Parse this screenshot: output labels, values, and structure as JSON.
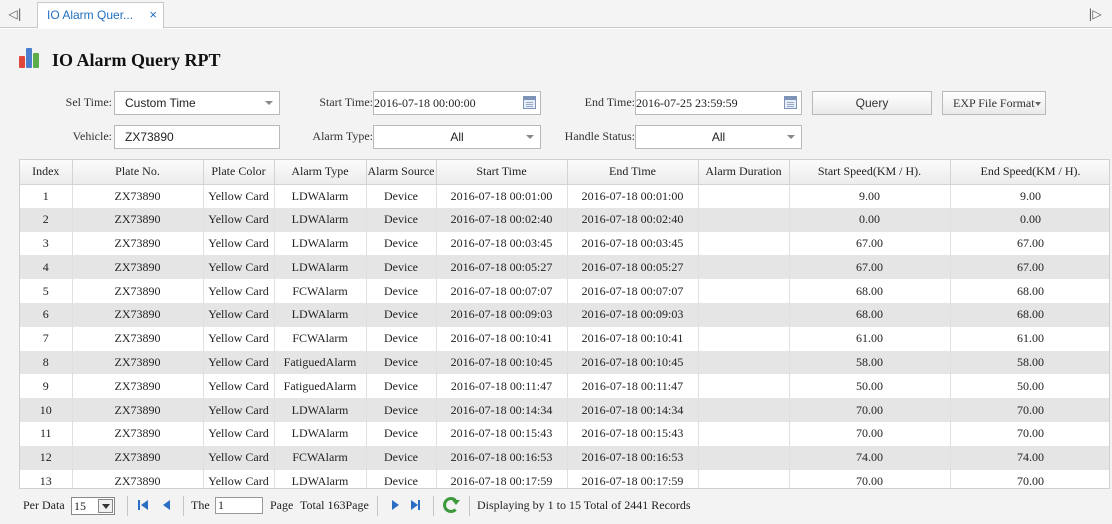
{
  "tabs": {
    "nav_left": "◁|",
    "nav_right": "|▷",
    "active_label": "IO Alarm Quer...",
    "close_glyph": "×"
  },
  "page": {
    "title": "IO Alarm Query RPT",
    "icon": "bar-chart-icon"
  },
  "filters": {
    "sel_time_label": "Sel Time:",
    "sel_time_value": "Custom Time",
    "start_time_label": "Start Time:",
    "start_time_value": "2016-07-18 00:00:00",
    "end_time_label": "End Time:",
    "end_time_value": "2016-07-25 23:59:59",
    "query_label": "Query",
    "exp_label": "EXP File Format",
    "vehicle_label": "Vehicle:",
    "vehicle_value": "ZX73890",
    "alarm_type_label": "Alarm Type:",
    "alarm_type_value": "All",
    "handle_status_label": "Handle Status:",
    "handle_status_value": "All"
  },
  "grid": {
    "columns": [
      "Index",
      "Plate No.",
      "Plate Color",
      "Alarm Type",
      "Alarm Source",
      "Start Time",
      "End Time",
      "Alarm Duration",
      "Start Speed(KM / H).",
      "End Speed(KM / H)."
    ],
    "rows": [
      [
        "1",
        "ZX73890",
        "Yellow Card",
        "LDWAlarm",
        "Device",
        "2016-07-18 00:01:00",
        "2016-07-18 00:01:00",
        "",
        "9.00",
        "9.00"
      ],
      [
        "2",
        "ZX73890",
        "Yellow Card",
        "LDWAlarm",
        "Device",
        "2016-07-18 00:02:40",
        "2016-07-18 00:02:40",
        "",
        "0.00",
        "0.00"
      ],
      [
        "3",
        "ZX73890",
        "Yellow Card",
        "LDWAlarm",
        "Device",
        "2016-07-18 00:03:45",
        "2016-07-18 00:03:45",
        "",
        "67.00",
        "67.00"
      ],
      [
        "4",
        "ZX73890",
        "Yellow Card",
        "LDWAlarm",
        "Device",
        "2016-07-18 00:05:27",
        "2016-07-18 00:05:27",
        "",
        "67.00",
        "67.00"
      ],
      [
        "5",
        "ZX73890",
        "Yellow Card",
        "FCWAlarm",
        "Device",
        "2016-07-18 00:07:07",
        "2016-07-18 00:07:07",
        "",
        "68.00",
        "68.00"
      ],
      [
        "6",
        "ZX73890",
        "Yellow Card",
        "LDWAlarm",
        "Device",
        "2016-07-18 00:09:03",
        "2016-07-18 00:09:03",
        "",
        "68.00",
        "68.00"
      ],
      [
        "7",
        "ZX73890",
        "Yellow Card",
        "FCWAlarm",
        "Device",
        "2016-07-18 00:10:41",
        "2016-07-18 00:10:41",
        "",
        "61.00",
        "61.00"
      ],
      [
        "8",
        "ZX73890",
        "Yellow Card",
        "FatiguedAlarm",
        "Device",
        "2016-07-18 00:10:45",
        "2016-07-18 00:10:45",
        "",
        "58.00",
        "58.00"
      ],
      [
        "9",
        "ZX73890",
        "Yellow Card",
        "FatiguedAlarm",
        "Device",
        "2016-07-18 00:11:47",
        "2016-07-18 00:11:47",
        "",
        "50.00",
        "50.00"
      ],
      [
        "10",
        "ZX73890",
        "Yellow Card",
        "LDWAlarm",
        "Device",
        "2016-07-18 00:14:34",
        "2016-07-18 00:14:34",
        "",
        "70.00",
        "70.00"
      ],
      [
        "11",
        "ZX73890",
        "Yellow Card",
        "LDWAlarm",
        "Device",
        "2016-07-18 00:15:43",
        "2016-07-18 00:15:43",
        "",
        "70.00",
        "70.00"
      ],
      [
        "12",
        "ZX73890",
        "Yellow Card",
        "FCWAlarm",
        "Device",
        "2016-07-18 00:16:53",
        "2016-07-18 00:16:53",
        "",
        "74.00",
        "74.00"
      ],
      [
        "13",
        "ZX73890",
        "Yellow Card",
        "LDWAlarm",
        "Device",
        "2016-07-18 00:17:59",
        "2016-07-18 00:17:59",
        "",
        "70.00",
        "70.00"
      ]
    ]
  },
  "pager": {
    "per_data_label": "Per Data",
    "per_data_value": "15",
    "the_label": "The",
    "page_value": "1",
    "page_label": "Page",
    "total_pages": "Total 163Page",
    "summary": "Displaying by 1 to 15 Total of 2441 Records"
  },
  "colors": {
    "tab_text": "#1f6fbf",
    "pager_arrows": "#2b6fc5",
    "refresh": "#3c9a3c",
    "row_alt": "#e5e5e5"
  }
}
